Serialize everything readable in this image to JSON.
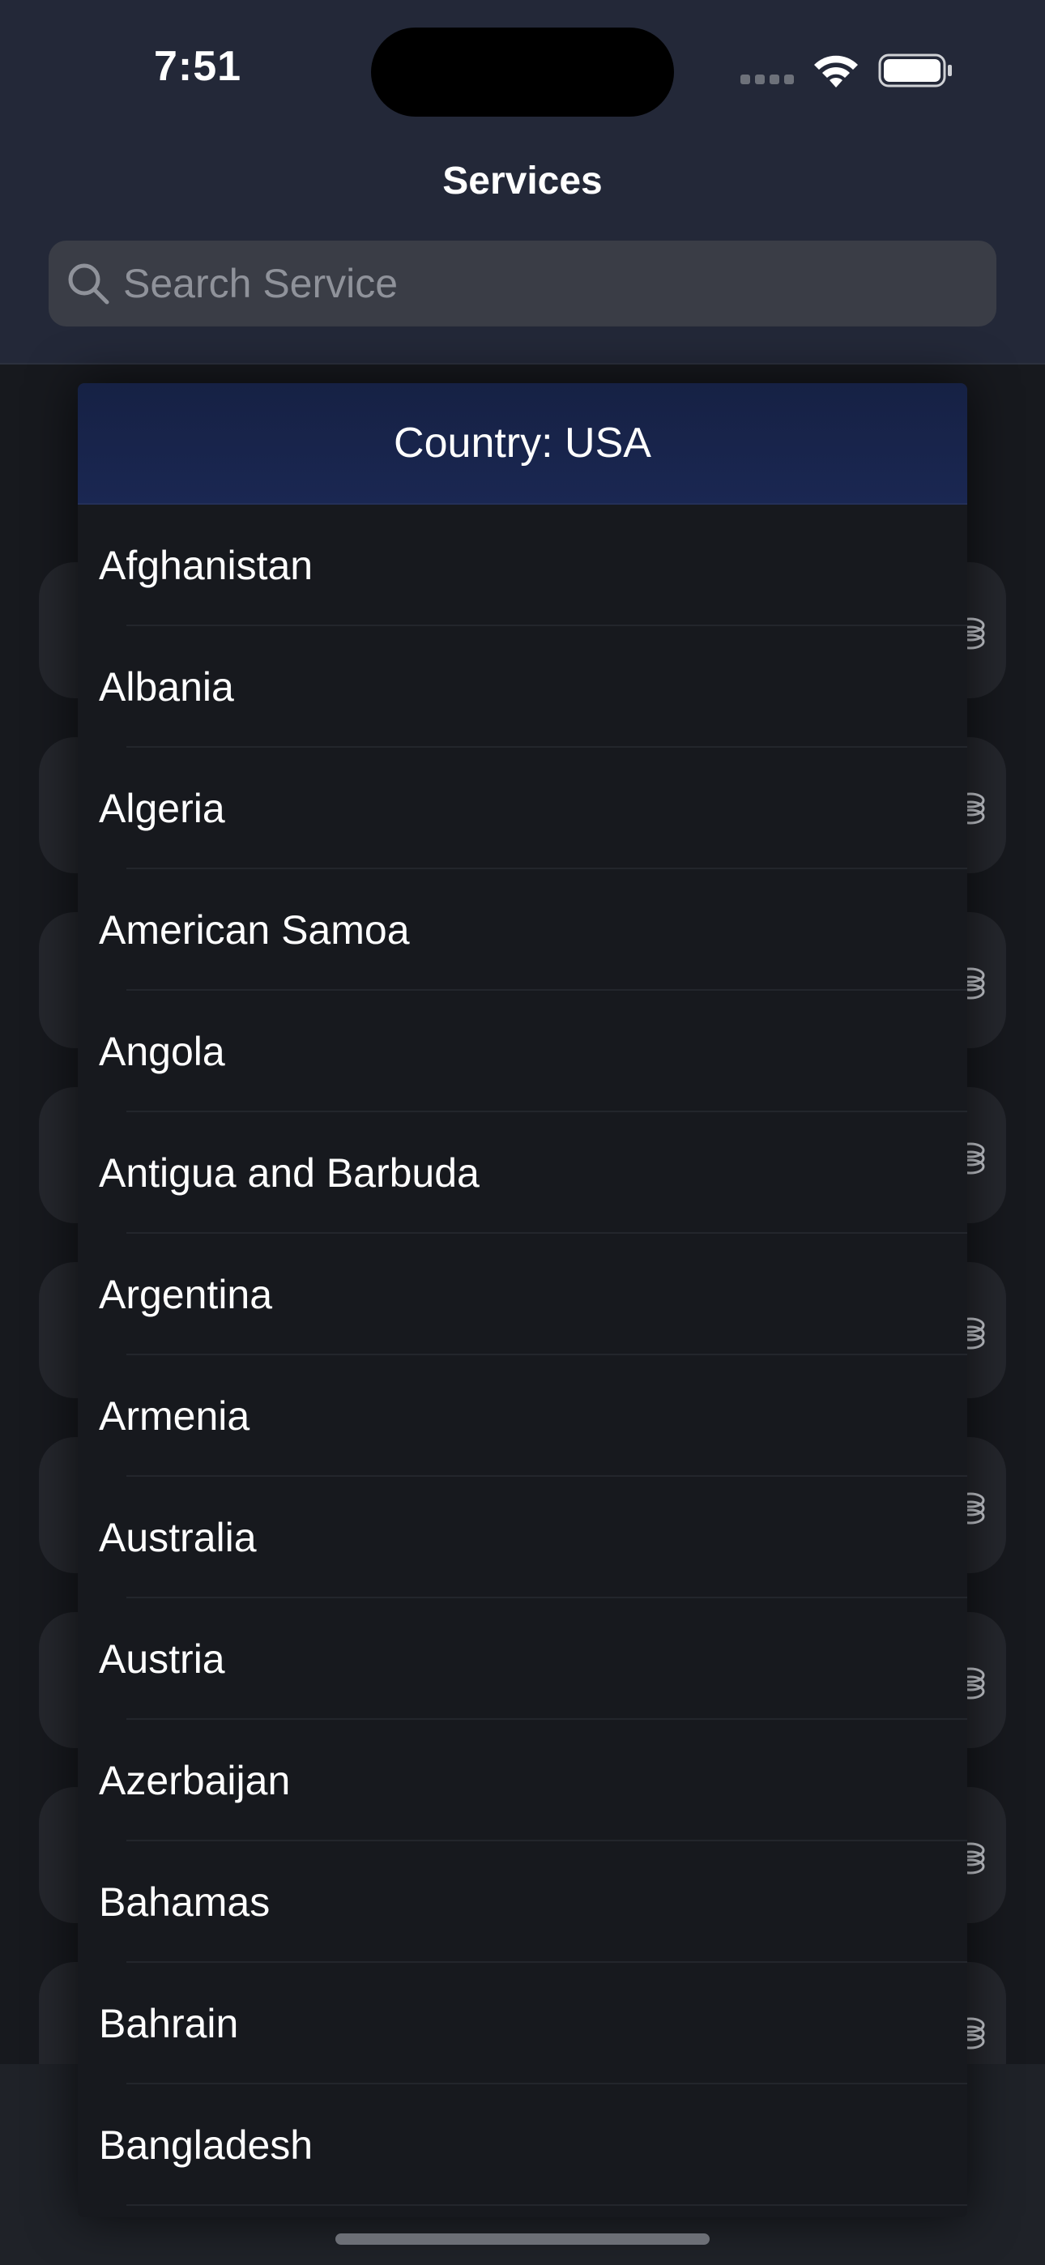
{
  "status_bar": {
    "time": "7:51"
  },
  "nav": {
    "title": "Services"
  },
  "search": {
    "placeholder": "Search Service",
    "value": ""
  },
  "dropdown": {
    "header": "Country: USA",
    "countries": [
      "Afghanistan",
      "Albania",
      "Algeria",
      "American Samoa",
      "Angola",
      "Antigua and Barbuda",
      "Argentina",
      "Armenia",
      "Australia",
      "Austria",
      "Azerbaijan",
      "Bahamas",
      "Bahrain",
      "Bangladesh"
    ]
  },
  "colors": {
    "header_bg": "#232838",
    "dropdown_header_bg": "#1a2752",
    "list_bg": "#17191e"
  }
}
